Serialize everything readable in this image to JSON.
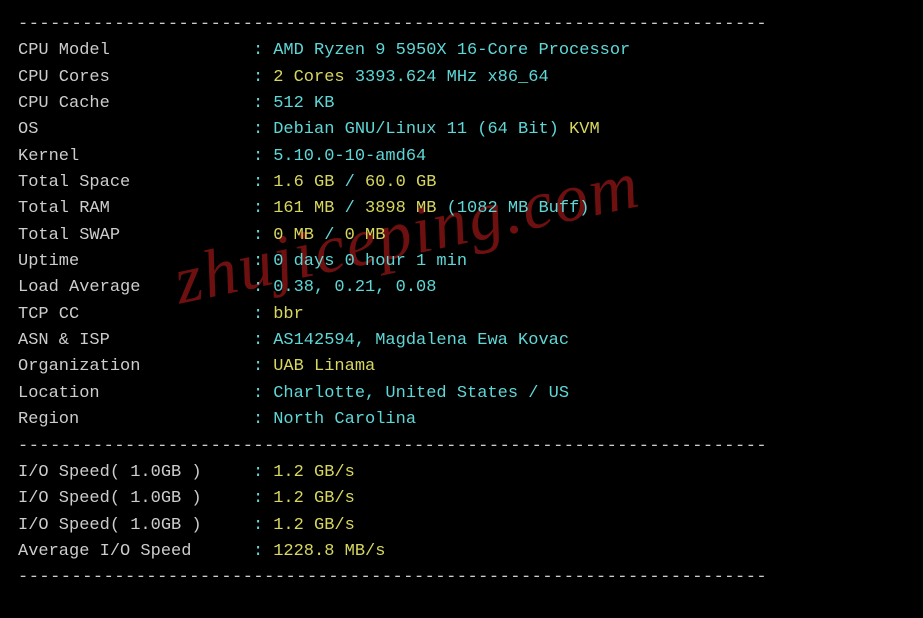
{
  "divider": "----------------------------------------------------------------------",
  "system": {
    "cpu_model": {
      "label": "CPU Model",
      "value": "AMD Ryzen 9 5950X 16-Core Processor"
    },
    "cpu_cores": {
      "label": "CPU Cores",
      "cores": "2 Cores",
      "freq": "3393.624 MHz x86_64"
    },
    "cpu_cache": {
      "label": "CPU Cache",
      "value": "512 KB"
    },
    "os": {
      "label": "OS",
      "name": "Debian GNU/Linux 11 (64 Bit)",
      "virt": "KVM"
    },
    "kernel": {
      "label": "Kernel",
      "value": "5.10.0-10-amd64"
    },
    "total_space": {
      "label": "Total Space",
      "used": "1.6 GB",
      "total": "60.0 GB"
    },
    "total_ram": {
      "label": "Total RAM",
      "used": "161 MB",
      "total": "3898 MB",
      "buff": "(1082 MB Buff)"
    },
    "total_swap": {
      "label": "Total SWAP",
      "used": "0 MB",
      "total": "0 MB"
    },
    "uptime": {
      "label": "Uptime",
      "value": "0 days 0 hour 1 min"
    },
    "load_avg": {
      "label": "Load Average",
      "value": "0.38, 0.21, 0.08"
    },
    "tcp_cc": {
      "label": "TCP CC",
      "value": "bbr"
    },
    "asn_isp": {
      "label": "ASN & ISP",
      "value": "AS142594, Magdalena Ewa Kovac"
    },
    "organization": {
      "label": "Organization",
      "value": "UAB Linama"
    },
    "location": {
      "label": "Location",
      "value": "Charlotte, United States / US"
    },
    "region": {
      "label": "Region",
      "value": "North Carolina"
    }
  },
  "io": {
    "tests": [
      {
        "label": "I/O Speed( 1.0GB )",
        "value": "1.2 GB/s"
      },
      {
        "label": "I/O Speed( 1.0GB )",
        "value": "1.2 GB/s"
      },
      {
        "label": "I/O Speed( 1.0GB )",
        "value": "1.2 GB/s"
      }
    ],
    "average": {
      "label": "Average I/O Speed",
      "value": "1228.8 MB/s"
    }
  },
  "watermark": "zhujiceping.com"
}
